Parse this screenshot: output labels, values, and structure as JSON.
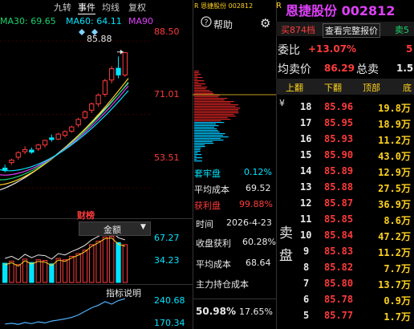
{
  "left_tabs": {
    "t1": "九转",
    "t2": "事件",
    "t3": "均线",
    "t4": "复权"
  },
  "ma_legend": {
    "ma30": "MA30: 69.65",
    "ma60": "MA60: 64.11",
    "ma90": "MA90"
  },
  "price_axis": {
    "p1": "88.50",
    "p2": "71.01",
    "p3": "53.51"
  },
  "peak_label": "85.88",
  "caibang": "财榜",
  "jine_select": "金额",
  "vol_axis": {
    "v1": "67.27",
    "v2": "34.23"
  },
  "indicator_btn": "指标说明",
  "ind_axis": {
    "i1": "240.68",
    "i2": "170.34"
  },
  "colors": {
    "up": "#ff3b3b",
    "down": "#00e5ff",
    "ma_yellow": "#ffd21f",
    "ma_green": "#19d36b",
    "ma_white": "#e8e8e8",
    "ma_magenta": "#e040fb"
  },
  "mid": {
    "title": "R 恩捷股份 002812",
    "help": "帮助",
    "taolao_label": "套牢盘",
    "taolao_val": "0.12%",
    "avgcost_label": "平均成本",
    "avgcost_val": "69.52",
    "profit_label": "获利盘",
    "profit_val": "99.88%",
    "time_label": "时间",
    "time_val": "2026-4-23",
    "close_profit_label": "收盘获利",
    "close_profit_val": "60.28%",
    "avgcost2_label": "平均成本",
    "avgcost2_val": "68.64",
    "main_label": "主力持仓成本",
    "bottom_a": "50.98%",
    "bottom_b": "17.65%"
  },
  "right": {
    "title": "恩捷股份 002812",
    "btn_buy": "买874档",
    "btn_full": "查看完整报价",
    "btn_sell": "卖5",
    "weibi_label": "委比",
    "weibi_val": "+13.07%",
    "weibi_tail": "5",
    "avgprice_label": "均卖价",
    "avgprice_val": "86.29",
    "total_label": "总卖",
    "total_val": "1.5",
    "headers": {
      "h1": "上翻",
      "h2": "下翻",
      "h3": "顶部",
      "h4": "底"
    },
    "yen": "¥",
    "side_label_1": "卖",
    "side_label_2": "盘",
    "rows": [
      {
        "lvl": "18",
        "price": "85.96",
        "vol": "19.8万"
      },
      {
        "lvl": "17",
        "price": "85.95",
        "vol": "18.9万"
      },
      {
        "lvl": "16",
        "price": "85.93",
        "vol": "11.2万"
      },
      {
        "lvl": "15",
        "price": "85.90",
        "vol": "43.0万"
      },
      {
        "lvl": "14",
        "price": "85.89",
        "vol": "12.9万"
      },
      {
        "lvl": "13",
        "price": "85.88",
        "vol": "27.5万"
      },
      {
        "lvl": "12",
        "price": "85.87",
        "vol": "36.9万"
      },
      {
        "lvl": "11",
        "price": "85.85",
        "vol": "8.6万"
      },
      {
        "lvl": "10",
        "price": "85.84",
        "vol": "47.2万"
      },
      {
        "lvl": "9",
        "price": "85.83",
        "vol": "11.2万"
      },
      {
        "lvl": "8",
        "price": "85.82",
        "vol": "7.7万"
      },
      {
        "lvl": "7",
        "price": "85.80",
        "vol": "13.7万"
      },
      {
        "lvl": "6",
        "price": "85.78",
        "vol": "0.9万"
      },
      {
        "lvl": "5",
        "price": "85.77",
        "vol": "1.7万"
      }
    ]
  },
  "chart_data": {
    "type": "bar",
    "title": "",
    "x": [
      1,
      2,
      3,
      4,
      5,
      6,
      7,
      8,
      9,
      10,
      11,
      12,
      13,
      14,
      15,
      16,
      17,
      18,
      19
    ],
    "candles": [
      {
        "o": 58.2,
        "h": 59.0,
        "c": 57.6,
        "l": 57.2
      },
      {
        "o": 59.5,
        "h": 60.4,
        "c": 60.1,
        "l": 59.0
      },
      {
        "o": 60.8,
        "h": 62.2,
        "c": 61.9,
        "l": 60.2
      },
      {
        "o": 62.1,
        "h": 63.4,
        "c": 62.6,
        "l": 61.5
      },
      {
        "o": 62.5,
        "h": 63.1,
        "c": 62.0,
        "l": 61.6
      },
      {
        "o": 62.8,
        "h": 64.0,
        "c": 63.7,
        "l": 62.3
      },
      {
        "o": 63.7,
        "h": 65.0,
        "c": 64.8,
        "l": 63.1
      },
      {
        "o": 65.4,
        "h": 66.2,
        "c": 65.0,
        "l": 64.5
      },
      {
        "o": 65.1,
        "h": 66.6,
        "c": 66.3,
        "l": 64.9
      },
      {
        "o": 66.0,
        "h": 67.2,
        "c": 66.9,
        "l": 65.5
      },
      {
        "o": 67.0,
        "h": 68.3,
        "c": 68.0,
        "l": 66.6
      },
      {
        "o": 68.5,
        "h": 70.2,
        "c": 69.8,
        "l": 67.9
      },
      {
        "o": 70.2,
        "h": 72.0,
        "c": 71.6,
        "l": 69.8
      },
      {
        "o": 72.0,
        "h": 73.8,
        "c": 73.5,
        "l": 71.3
      },
      {
        "o": 73.5,
        "h": 76.0,
        "c": 75.6,
        "l": 72.8
      },
      {
        "o": 75.8,
        "h": 79.5,
        "c": 79.0,
        "l": 75.2
      },
      {
        "o": 79.2,
        "h": 82.5,
        "c": 81.9,
        "l": 78.4
      },
      {
        "o": 82.0,
        "h": 84.8,
        "c": 80.4,
        "l": 79.6
      },
      {
        "o": 80.4,
        "h": 85.88,
        "c": 85.7,
        "l": 80.0
      }
    ],
    "ylim": [
      47,
      91
    ],
    "volumes": {
      "values": [
        28,
        31,
        26,
        34,
        29,
        33,
        32,
        27,
        35,
        33,
        38,
        42,
        47,
        55,
        60,
        66,
        67,
        58,
        55
      ],
      "ylim": [
        0,
        70
      ]
    },
    "indicator": {
      "values": [
        170,
        172,
        169,
        174,
        171,
        176,
        173,
        178,
        181,
        184,
        188,
        195,
        205,
        215,
        222,
        232,
        225,
        235,
        240
      ],
      "ylim": [
        165,
        245
      ]
    }
  }
}
